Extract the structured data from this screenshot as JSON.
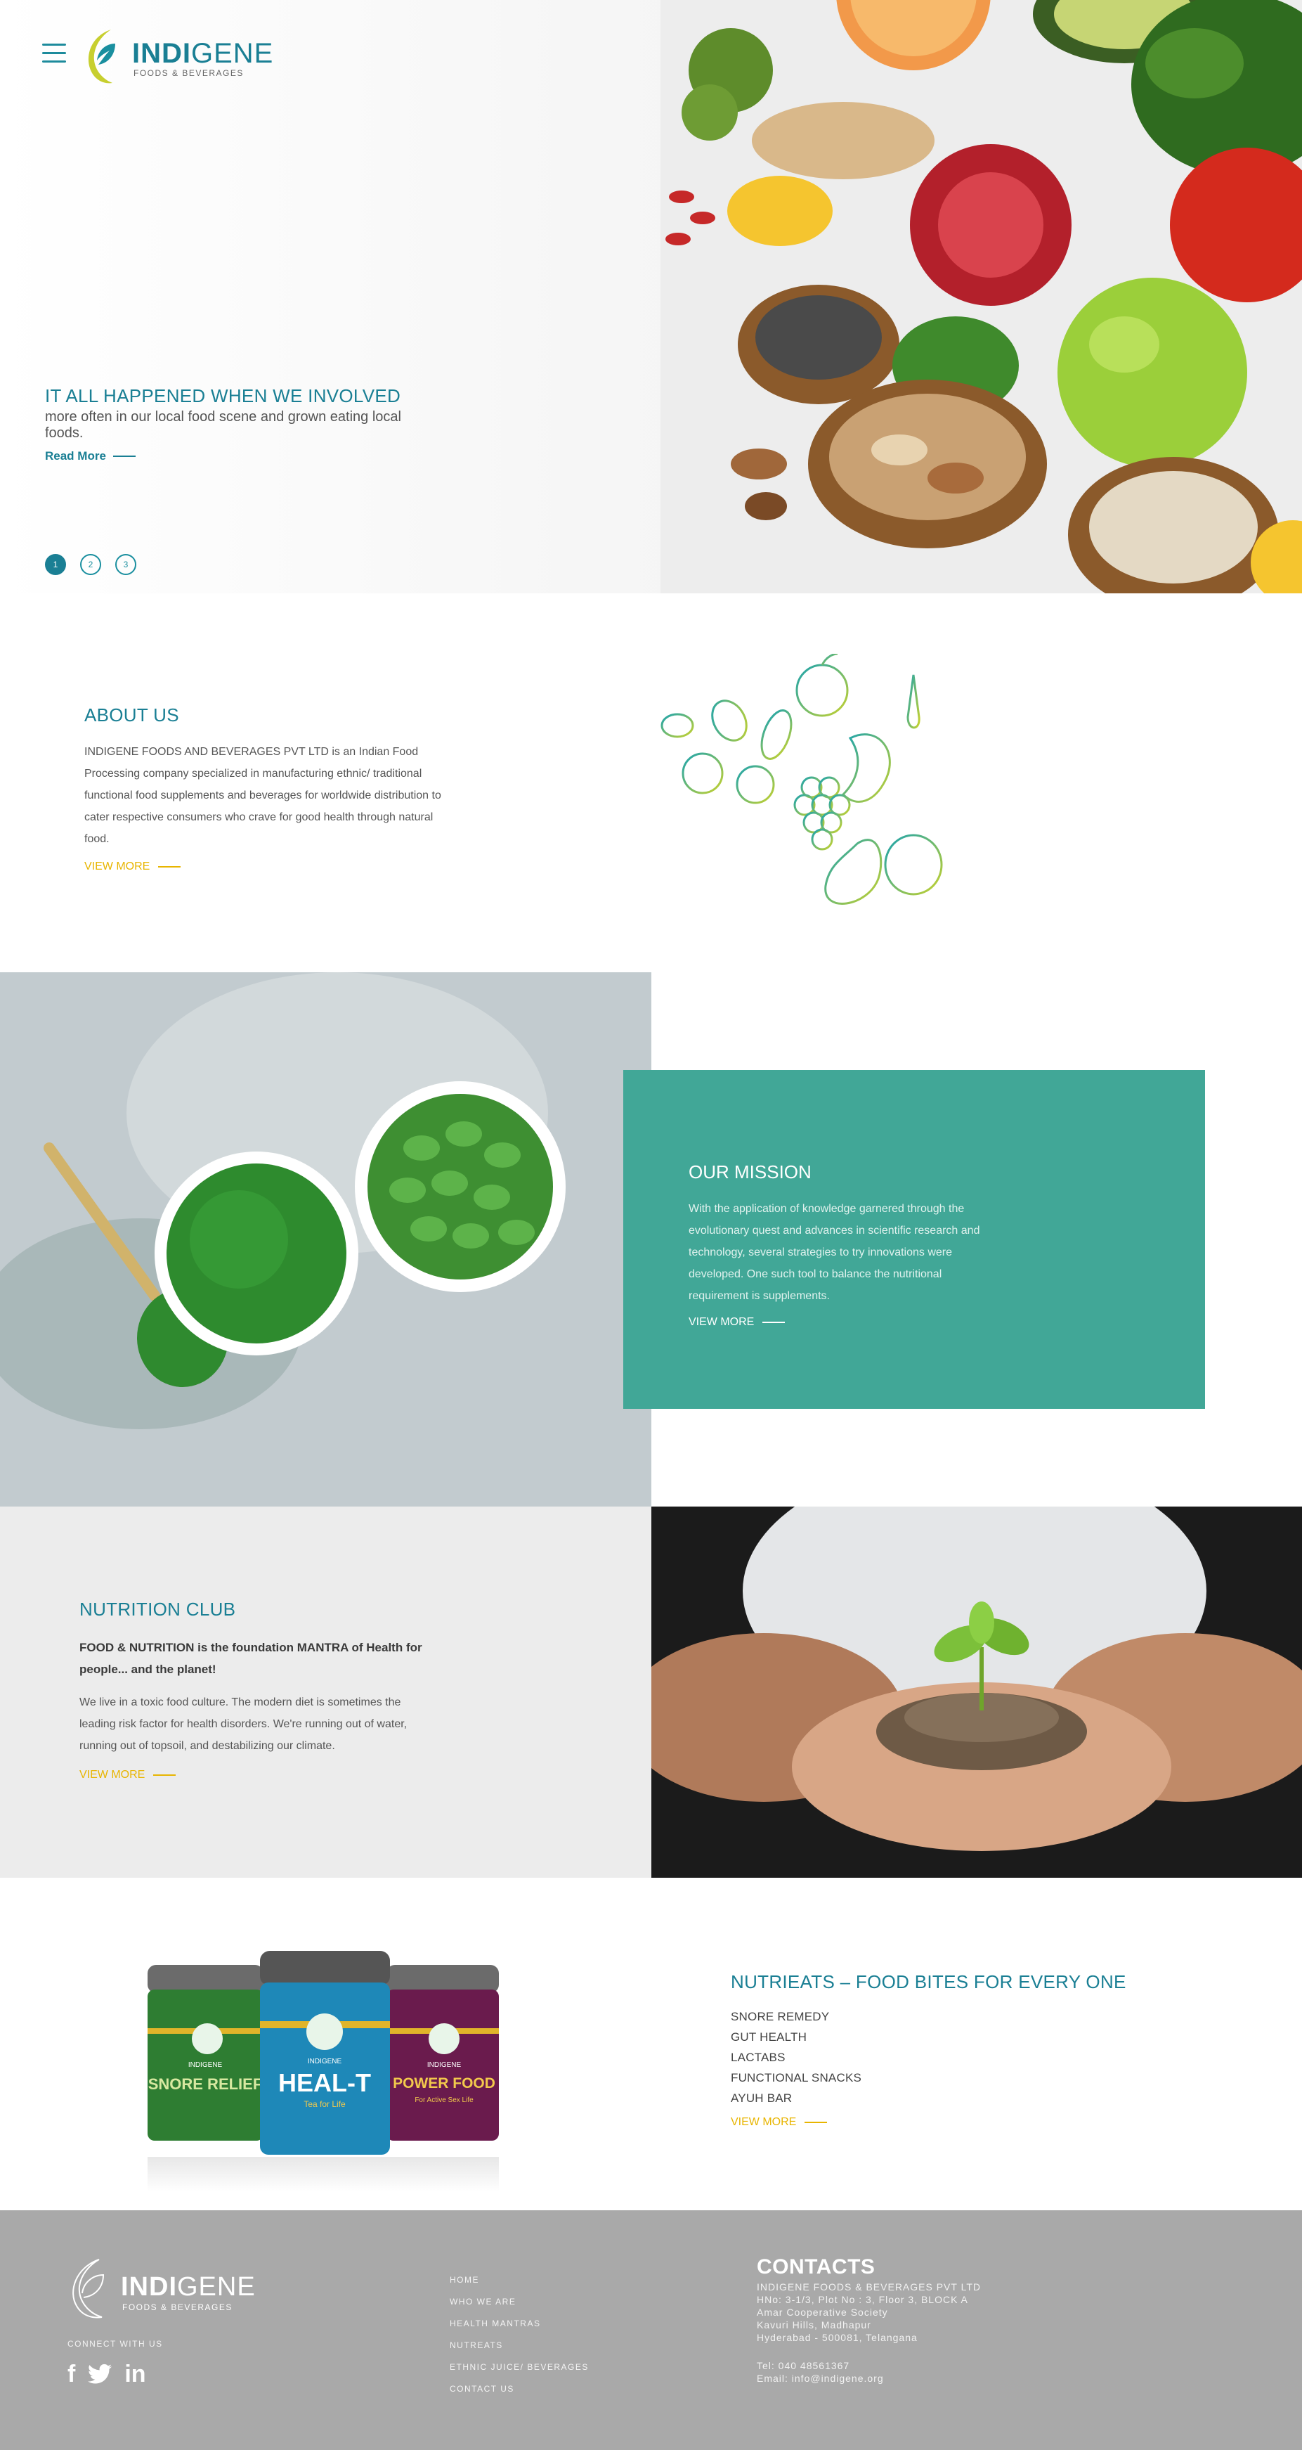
{
  "brand": {
    "name_bold": "INDI",
    "name_rest": "GENE",
    "tagline": "FOODS & BEVERAGES"
  },
  "hero": {
    "title": "IT ALL HAPPENED WHEN WE INVOLVED",
    "text": "more often in our local food scene and grown eating local foods.",
    "read_more": "Read More",
    "slides": [
      "1",
      "2",
      "3"
    ],
    "active_slide": 1
  },
  "about": {
    "title": "ABOUT US",
    "text": "INDIGENE FOODS AND BEVERAGES PVT LTD is an Indian Food Processing company specialized in manufacturing ethnic/ traditional functional food supplements and beverages for worldwide distribution to cater respective consumers who crave for good health through natural food.",
    "link": "VIEW MORE"
  },
  "mission": {
    "title": "OUR MISSION",
    "text": "With the application of knowledge garnered through the evolutionary quest and advances in scientific research and technology, several strategies to try innovations were developed. One such tool to balance the nutritional requirement is supplements.",
    "link": "VIEW MORE"
  },
  "nutrition_club": {
    "title": "NUTRITION CLUB",
    "bold_text": "FOOD & NUTRITION is the foundation MANTRA of Health for people... and the planet!",
    "text": "We live in a toxic food culture. The modern diet is sometimes the leading risk factor for health disorders. We're running out of water, running out of topsoil, and destabilizing our climate.",
    "link": "VIEW MORE"
  },
  "products": {
    "jars": [
      {
        "brand": "INDIGENE",
        "name": "SNORE RELIEF",
        "color": "#2e7d32"
      },
      {
        "brand": "INDIGENE",
        "name": "HEAL-T",
        "subtitle": "Tea for Life",
        "color": "#1e88b8"
      },
      {
        "brand": "INDIGENE",
        "name": "POWER FOOD",
        "subtitle": "For Active Sex Life",
        "color": "#6a1b4d"
      }
    ]
  },
  "nutrieats": {
    "title": "NUTRIEATS – FOOD BITES FOR EVERY ONE",
    "items": [
      "SNORE REMEDY",
      "GUT HEALTH",
      "LACTABS",
      "FUNCTIONAL SNACKS",
      "AYUH BAR"
    ],
    "link": "VIEW MORE"
  },
  "footer": {
    "connect": "CONNECT WITH US",
    "social": [
      "f",
      "twitter-bird",
      "in"
    ],
    "nav": [
      "HOME",
      "WHO WE ARE",
      "HEALTH MANTRAS",
      "NUTREATS",
      "ETHNIC JUICE/ BEVERAGES",
      "CONTACT US"
    ],
    "contacts_title": "CONTACTS",
    "address": [
      "INDIGENE FOODS & BEVERAGES PVT LTD",
      "HNo: 3-1/3, Plot No : 3, Floor 3, BLOCK A",
      "Amar Cooperative Society",
      "Kavuri Hills, Madhapur",
      "Hyderabad - 500081, Telangana"
    ],
    "tel": "Tel: 040 48561367",
    "email": "Email: info@indigene.org"
  },
  "colors": {
    "teal": "#1a7f94",
    "mission_bg": "#41a797",
    "accent_yellow": "#e8b500",
    "footer_bg": "#a9a9a9",
    "club_bg": "#ececec"
  }
}
